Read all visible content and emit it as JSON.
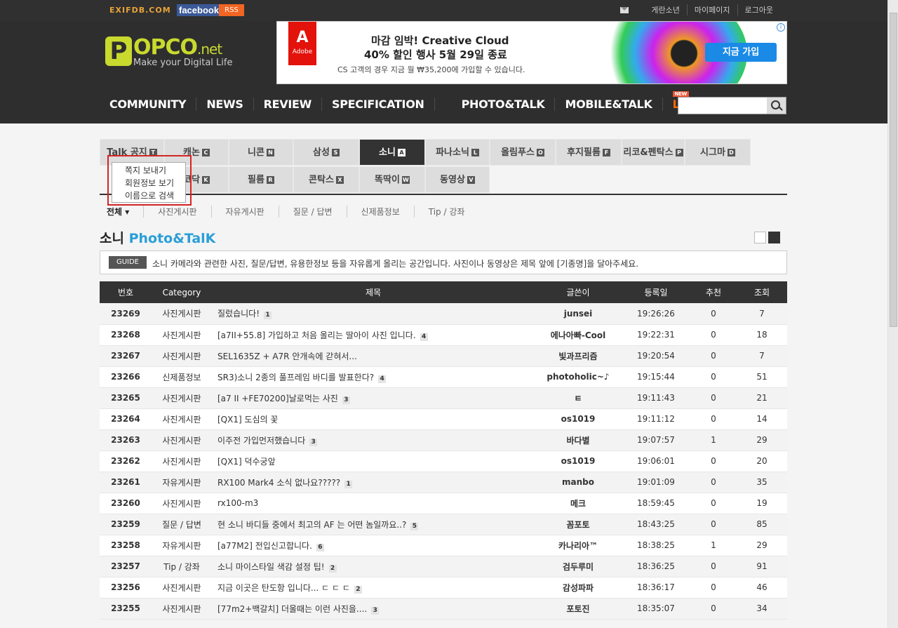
{
  "topbar": {
    "exif": "EXIFDB.COM",
    "facebook": "facebook",
    "rss": "RSS",
    "links": [
      "게란소년",
      "마이페이지",
      "로그아웃"
    ]
  },
  "logo": {
    "main": "POPCO",
    "suffix": ".net",
    "tagline": "Make your Digital Life"
  },
  "ad": {
    "brand": "Adobe",
    "headline1": "마감 임박! Creative Cloud",
    "headline2": "40% 할인 행사 5월 29일 종료",
    "sub": "CS 고객의 경우 지금 월 ₩35,200에 가입할 수 있습니다.",
    "cta": "지금 가입"
  },
  "nav": {
    "items": [
      "COMMUNITY",
      "NEWS",
      "REVIEW",
      "SPECIFICATION",
      "PHOTO&TALK",
      "MOBILE&TALK",
      "LINK"
    ],
    "new_badge": "NEW"
  },
  "brand_tabs": [
    {
      "label": "Talk 공지",
      "key": "T"
    },
    {
      "label": "캐논",
      "key": "C"
    },
    {
      "label": "니콘",
      "key": "N"
    },
    {
      "label": "삼성",
      "key": "S"
    },
    {
      "label": "소니",
      "key": "A"
    },
    {
      "label": "파나소닉",
      "key": "L"
    },
    {
      "label": "올림푸스",
      "key": "O"
    },
    {
      "label": "후지필름",
      "key": "F"
    },
    {
      "label": "리코&펜탁스",
      "key": "P"
    },
    {
      "label": "시그마",
      "key": "D"
    },
    {
      "label": "코닥",
      "key": "K"
    },
    {
      "label": "필름",
      "key": "R"
    },
    {
      "label": "콘탁스",
      "key": "X"
    },
    {
      "label": "똑딱이",
      "key": "W"
    },
    {
      "label": "동영상",
      "key": "V"
    }
  ],
  "popup_menu": [
    "쪽지 보내기",
    "회원정보 보기",
    "이름으로 검색"
  ],
  "sub_tabs": [
    "전체 ▾",
    "사진게시판",
    "자유게시판",
    "질문 / 답변",
    "신제품정보",
    "Tip / 강좌"
  ],
  "page_title": {
    "brand": "소니",
    "section": "Photo&TalK"
  },
  "guide": {
    "badge": "GUIDE",
    "text": "소니 카메라와 관련한 사진, 질문/답변, 유용한정보 등을 자유롭게 올리는 공간입니다. 사진이나 동영상은 제목 앞에 [기종명]을 달아주세요."
  },
  "table": {
    "headers": [
      "번호",
      "Category",
      "제목",
      "글쓴이",
      "등록일",
      "추천",
      "조회"
    ],
    "rows": [
      {
        "num": "23269",
        "cat": "사진게시판",
        "title": "질렀습니다!",
        "cc": "1",
        "author": "junsei",
        "time": "19:26:26",
        "rec": "0",
        "views": "7"
      },
      {
        "num": "23268",
        "cat": "사진게시판",
        "title": "[a7II+55.8] 가입하고 처음 올리는 딸아이 사진 입니다.",
        "cc": "4",
        "author": "에나아빠-Cool",
        "time": "19:22:31",
        "rec": "0",
        "views": "18"
      },
      {
        "num": "23267",
        "cat": "사진게시판",
        "title": "SEL1635Z + A7R 안개속에 갇혀서...",
        "cc": "",
        "author": "빛과프리즘",
        "time": "19:20:54",
        "rec": "0",
        "views": "7"
      },
      {
        "num": "23266",
        "cat": "신제품정보",
        "title": "SR3)소니 2종의 풀프레임 바디를 발표한다?",
        "cc": "4",
        "author": "photoholic~♪",
        "time": "19:15:44",
        "rec": "0",
        "views": "51"
      },
      {
        "num": "23265",
        "cat": "사진게시판",
        "title": "[a7 II +FE70200]날로먹는 사진",
        "cc": "3",
        "author": "ㅌ",
        "time": "19:11:43",
        "rec": "0",
        "views": "21"
      },
      {
        "num": "23264",
        "cat": "사진게시판",
        "title": "[QX1] 도심의 꽃",
        "cc": "",
        "author": "os1019",
        "time": "19:11:12",
        "rec": "0",
        "views": "14"
      },
      {
        "num": "23263",
        "cat": "사진게시판",
        "title": "이주전 가입먼저했습니다",
        "cc": "3",
        "author": "바다별",
        "time": "19:07:57",
        "rec": "1",
        "views": "29"
      },
      {
        "num": "23262",
        "cat": "사진게시판",
        "title": "[QX1] 덕수궁앞",
        "cc": "",
        "author": "os1019",
        "time": "19:06:01",
        "rec": "0",
        "views": "20"
      },
      {
        "num": "23261",
        "cat": "자유게시판",
        "title": "RX100 Mark4 소식 없나요?????",
        "cc": "1",
        "author": "manbo",
        "time": "19:01:09",
        "rec": "0",
        "views": "35"
      },
      {
        "num": "23260",
        "cat": "사진게시판",
        "title": "rx100-m3",
        "cc": "",
        "author": "메크",
        "time": "18:59:45",
        "rec": "0",
        "views": "19"
      },
      {
        "num": "23259",
        "cat": "질문 / 답변",
        "title": "현 소니 바디들 중에서 최고의 AF 는 어떤 놈일까요..?",
        "cc": "5",
        "author": "꼼포토",
        "time": "18:43:25",
        "rec": "0",
        "views": "85"
      },
      {
        "num": "23258",
        "cat": "자유게시판",
        "title": "[a77M2] 전입신고합니다.",
        "cc": "6",
        "author": "카나리아™",
        "time": "18:38:25",
        "rec": "1",
        "views": "29"
      },
      {
        "num": "23257",
        "cat": "Tip / 강좌",
        "title": "소니 마이스타일 색감 설정 팁!",
        "cc": "2",
        "author": "검두루미",
        "time": "18:36:25",
        "rec": "0",
        "views": "91"
      },
      {
        "num": "23256",
        "cat": "사진게시판",
        "title": "지금 이곳은 탄도항 입니다... ㄷ ㄷ ㄷ",
        "cc": "2",
        "author": "감성파파",
        "time": "18:36:17",
        "rec": "0",
        "views": "46"
      },
      {
        "num": "23255",
        "cat": "사진게시판",
        "title": "[77m2+백갈치] 더울때는 이런 사진을....",
        "cc": "3",
        "author": "포토진",
        "time": "18:35:07",
        "rec": "0",
        "views": "34"
      }
    ]
  }
}
